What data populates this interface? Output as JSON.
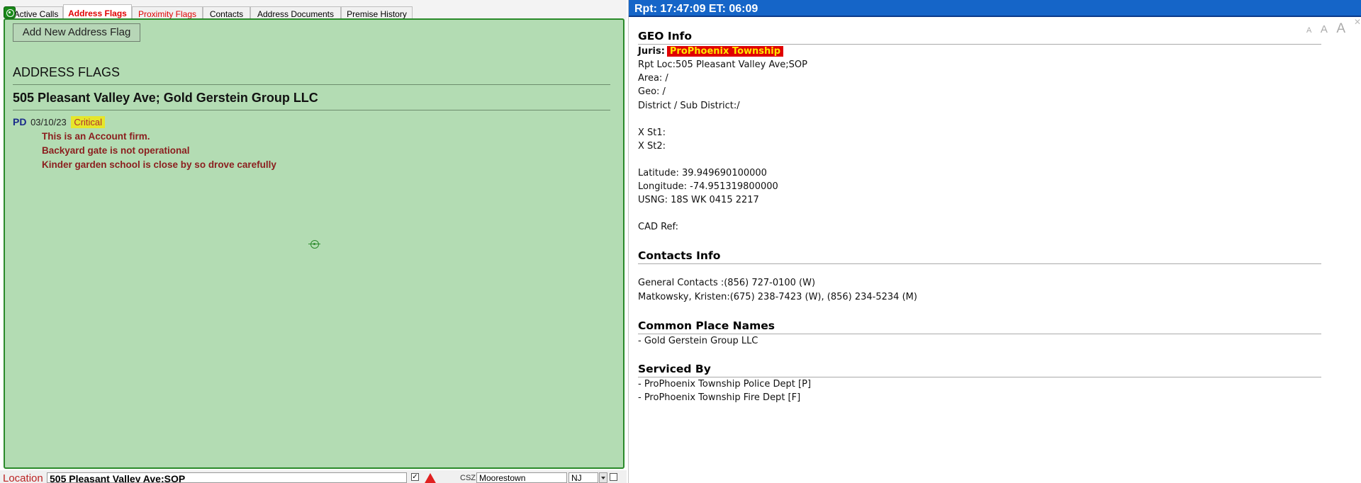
{
  "left": {
    "tabs": [
      {
        "label": "Active Calls"
      },
      {
        "label": "Address Flags"
      },
      {
        "label": "Proximity Flags"
      },
      {
        "label": "Contacts"
      },
      {
        "label": "Address Documents"
      },
      {
        "label": "Premise History"
      }
    ],
    "active_tab": "Address Flags",
    "add_button_label": "Add New Address Flag",
    "section_heading": "ADDRESS FLAGS",
    "address_title": "505 Pleasant Valley Ave; Gold Gerstein Group LLC",
    "flag": {
      "agency": "PD",
      "date": "03/10/23",
      "severity": "Critical",
      "notes": [
        "This is an Account firm.",
        "Backyard gate is not operational",
        "Kinder garden school is close by so drove carefully"
      ]
    },
    "location_bar": {
      "label": "Location",
      "value": "505 Pleasant Valley Ave;SOP",
      "check_mark": "✓",
      "csz_label": "CSZ",
      "city": "Moorestown",
      "state": "NJ"
    }
  },
  "right": {
    "header": "Rpt: 17:47:09  ET: 06:09",
    "font_sizes": [
      "A",
      "A",
      "A"
    ],
    "close_glyph": "✕",
    "geo": {
      "heading": "GEO Info",
      "juris_label": "Juris:",
      "juris_value": "ProPhoenix Township",
      "rpt_loc": "Rpt Loc:505 Pleasant Valley Ave;SOP",
      "area": "Area: /",
      "geo": "Geo: /",
      "district": "District / Sub District:/",
      "xst1": "X St1:",
      "xst2": "X St2:",
      "latitude": "Latitude: 39.949690100000",
      "longitude": "Longitude: -74.951319800000",
      "usng": "USNG: 18S WK 0415 2217",
      "cad_ref": "CAD Ref:"
    },
    "contacts": {
      "heading": "Contacts Info",
      "lines": [
        "General Contacts :(856) 727-0100 (W)",
        "Matkowsky, Kristen:(675) 238-7423 (W), (856) 234-5234 (M)"
      ]
    },
    "common_names": {
      "heading": "Common Place Names",
      "lines": [
        "- Gold Gerstein Group LLC"
      ]
    },
    "serviced_by": {
      "heading": "Serviced By",
      "lines": [
        "- ProPhoenix Township Police Dept [P]",
        "- ProPhoenix Township Fire Dept [F]"
      ]
    }
  },
  "colors": {
    "panel_green": "#b3dcb3",
    "panel_border": "#2a8a2a",
    "header_blue": "#1565c8",
    "flag_note_red": "#8b1e1e",
    "juris_bg": "#e00000",
    "juris_text": "#ffe600",
    "critical_bg": "#e6e62a"
  },
  "icons": [
    "app-status-icon",
    "locate-icon",
    "warning-icon",
    "chevron-down-icon"
  ]
}
